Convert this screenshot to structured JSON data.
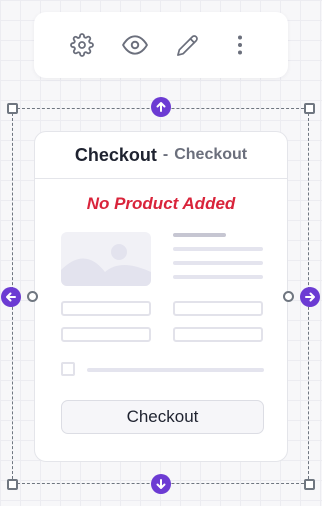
{
  "toolbar": {
    "icons": [
      "gear-icon",
      "eye-icon",
      "pencil-icon",
      "more-vertical-icon"
    ]
  },
  "widget": {
    "title": "Checkout",
    "title_separator": "-",
    "subtitle": "Checkout",
    "notice": "No Product Added",
    "button_label": "Checkout"
  },
  "colors": {
    "accent": "#6c3bd3",
    "notice": "#d9243b",
    "frame": "#6f7680"
  }
}
